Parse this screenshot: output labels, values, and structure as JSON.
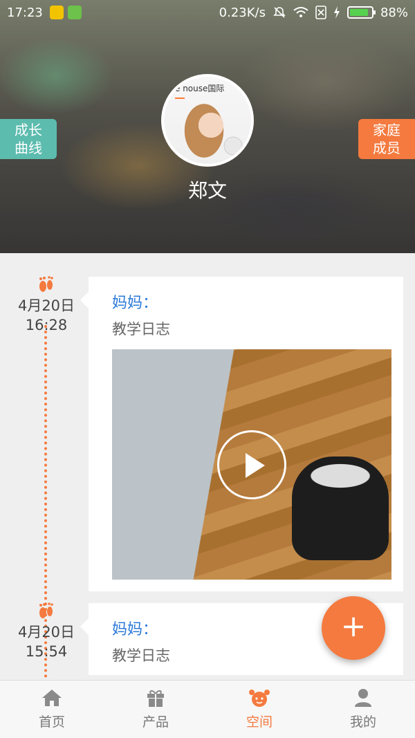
{
  "status_bar": {
    "time": "17:23",
    "network_speed": "0.23K/s",
    "battery": "88%",
    "battery_level": 0.88
  },
  "header": {
    "avatar_brand_text": "e nouse国际",
    "user_name": "郑文",
    "left_tab": {
      "line1": "成长",
      "line2": "曲线"
    },
    "right_tab": {
      "line1": "家庭",
      "line2": "成员"
    }
  },
  "timeline": [
    {
      "date": "4月20日",
      "time": "16:28",
      "author": "妈妈：",
      "title": "教学日志",
      "has_video": true
    },
    {
      "date": "4月20日",
      "time": "15:54",
      "author": "妈妈：",
      "title": "教学日志",
      "has_video": false
    }
  ],
  "fab": {
    "label": "+"
  },
  "bottom_nav": [
    {
      "label": "首页",
      "icon": "home-icon",
      "active": false
    },
    {
      "label": "产品",
      "icon": "gift-icon",
      "active": false
    },
    {
      "label": "空间",
      "icon": "kid-face-icon",
      "active": true
    },
    {
      "label": "我的",
      "icon": "person-icon",
      "active": false
    }
  ],
  "colors": {
    "accent": "#f47a3f",
    "teal": "#5cbcae",
    "author_blue": "#2a78d8"
  }
}
